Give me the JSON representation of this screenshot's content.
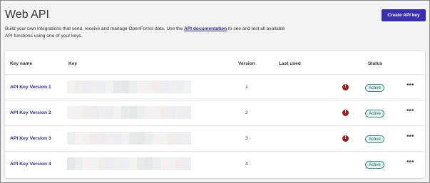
{
  "header": {
    "title": "Web API",
    "create_button": "Create API key"
  },
  "description": {
    "before_link": "Build your own integrations that send, receive and manage OpenForms data. Use the ",
    "link_text": "API documentation",
    "after_link": " to see and test all available API functions using one of your keys."
  },
  "table": {
    "columns": {
      "key_name": "Key name",
      "key": "Key",
      "version": "Version",
      "last_used": "Last used",
      "status": "Status"
    },
    "rows": [
      {
        "name": "API Key Version 1",
        "version": "1",
        "last_used": "",
        "status": "Active",
        "alert": "!"
      },
      {
        "name": "API Key Version 2",
        "version": "2",
        "last_used": "",
        "status": "Active",
        "alert": "!"
      },
      {
        "name": "API Key Version 3",
        "version": "3",
        "last_used": "",
        "status": "Active",
        "alert": "!"
      },
      {
        "name": "API Key Version 4",
        "version": "4",
        "last_used": "",
        "status": "Active"
      }
    ],
    "more_label": "•••"
  }
}
